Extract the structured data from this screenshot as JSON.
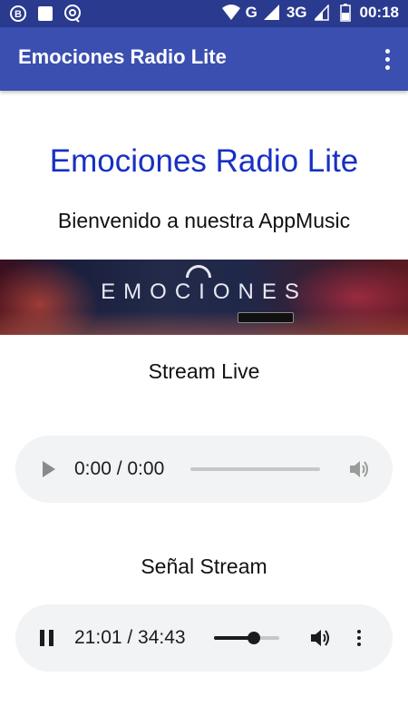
{
  "status_bar": {
    "time": "00:18",
    "network": "G",
    "network2": "3G",
    "notification_icons": [
      "b-circle-icon",
      "square-icon",
      "chat-icon"
    ]
  },
  "app_bar": {
    "title": "Emociones Radio Lite",
    "overflow_icon": "more-vert-icon"
  },
  "content": {
    "title": "Emociones Radio Lite",
    "subtitle": "Bienvenido a nuestra AppMusic",
    "banner": {
      "logo_text": "EMOCIONES"
    }
  },
  "players": [
    {
      "label": "Stream Live",
      "state": "paused",
      "time": "0:00 / 0:00",
      "progress": 0
    },
    {
      "label": "Señal Stream",
      "state": "playing",
      "time": "21:01 / 34:43",
      "progress": 0.605
    }
  ],
  "colors": {
    "status_bar": "#2a3a8f",
    "app_bar": "#3a4fb0",
    "title_accent": "#1730c4",
    "player_bg": "#f1f3f4"
  }
}
